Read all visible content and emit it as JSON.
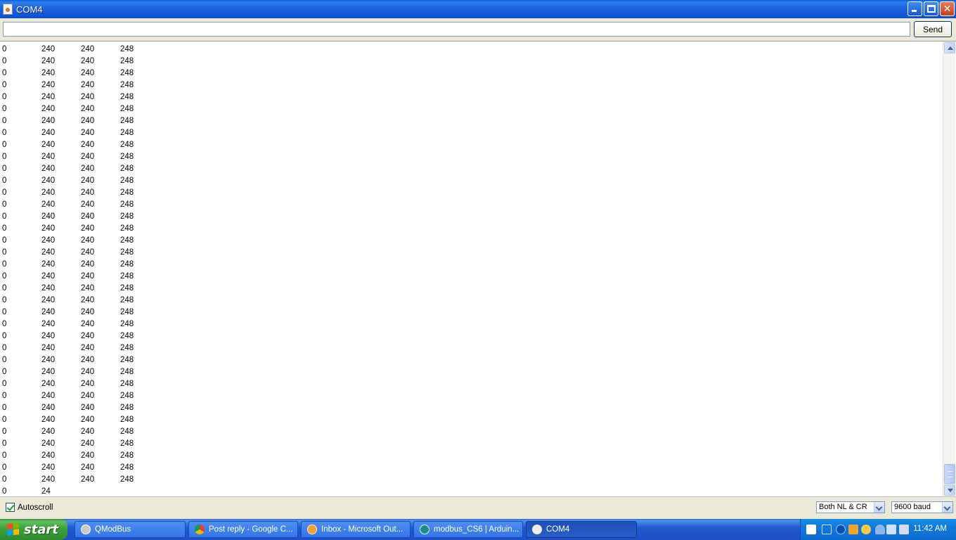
{
  "window": {
    "title": "COM4"
  },
  "send": {
    "input_value": "",
    "button_label": "Send"
  },
  "log": {
    "lines": [
      [
        "0",
        "240",
        "240",
        "248"
      ],
      [
        "0",
        "240",
        "240",
        "248"
      ],
      [
        "0",
        "240",
        "240",
        "248"
      ],
      [
        "0",
        "240",
        "240",
        "248"
      ],
      [
        "0",
        "240",
        "240",
        "248"
      ],
      [
        "0",
        "240",
        "240",
        "248"
      ],
      [
        "0",
        "240",
        "240",
        "248"
      ],
      [
        "0",
        "240",
        "240",
        "248"
      ],
      [
        "0",
        "240",
        "240",
        "248"
      ],
      [
        "0",
        "240",
        "240",
        "248"
      ],
      [
        "0",
        "240",
        "240",
        "248"
      ],
      [
        "0",
        "240",
        "240",
        "248"
      ],
      [
        "0",
        "240",
        "240",
        "248"
      ],
      [
        "0",
        "240",
        "240",
        "248"
      ],
      [
        "0",
        "240",
        "240",
        "248"
      ],
      [
        "0",
        "240",
        "240",
        "248"
      ],
      [
        "0",
        "240",
        "240",
        "248"
      ],
      [
        "0",
        "240",
        "240",
        "248"
      ],
      [
        "0",
        "240",
        "240",
        "248"
      ],
      [
        "0",
        "240",
        "240",
        "248"
      ],
      [
        "0",
        "240",
        "240",
        "248"
      ],
      [
        "0",
        "240",
        "240",
        "248"
      ],
      [
        "0",
        "240",
        "240",
        "248"
      ],
      [
        "0",
        "240",
        "240",
        "248"
      ],
      [
        "0",
        "240",
        "240",
        "248"
      ],
      [
        "0",
        "240",
        "240",
        "248"
      ],
      [
        "0",
        "240",
        "240",
        "248"
      ],
      [
        "0",
        "240",
        "240",
        "248"
      ],
      [
        "0",
        "240",
        "240",
        "248"
      ],
      [
        "0",
        "240",
        "240",
        "248"
      ],
      [
        "0",
        "240",
        "240",
        "248"
      ],
      [
        "0",
        "240",
        "240",
        "248"
      ],
      [
        "0",
        "240",
        "240",
        "248"
      ],
      [
        "0",
        "240",
        "240",
        "248"
      ],
      [
        "0",
        "240",
        "240",
        "248"
      ],
      [
        "0",
        "240",
        "240",
        "248"
      ],
      [
        "0",
        "240",
        "240",
        "248"
      ],
      [
        "0",
        "24",
        "",
        ""
      ]
    ]
  },
  "footer": {
    "autoscroll_label": "Autoscroll",
    "autoscroll_checked": true,
    "line_ending": "Both NL & CR",
    "baud_rate": "9600 baud"
  },
  "taskbar": {
    "start_label": "start",
    "tasks": [
      {
        "label": "QModBus",
        "icon": "qmodbus-icon"
      },
      {
        "label": "Post reply - Google C...",
        "icon": "chrome-icon"
      },
      {
        "label": "Inbox - Microsoft Out...",
        "icon": "outlook-icon"
      },
      {
        "label": "modbus_CS6 | Arduin...",
        "icon": "arduino-icon"
      },
      {
        "label": "COM4",
        "icon": "java-icon"
      }
    ],
    "clock": "11:42 AM"
  }
}
